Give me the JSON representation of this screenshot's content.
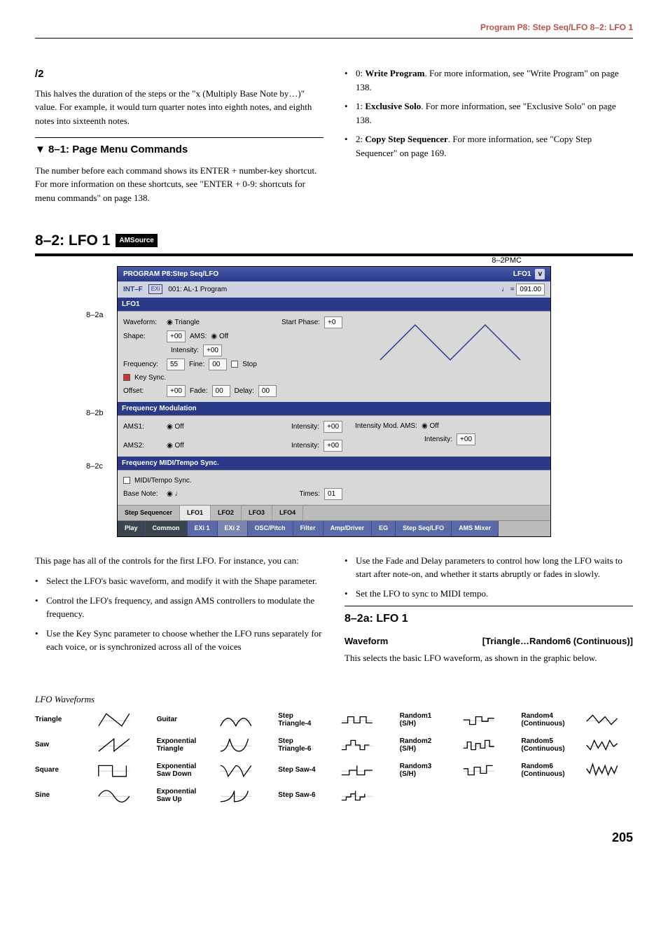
{
  "header": "Program P8: Step Seq/LFO     8–2: LFO 1",
  "left": {
    "half_title": "/2",
    "half_body": "This halves the duration of the steps or the \"x (Multiply Base Note by…)\" value. For example, it would turn quarter notes into eighth notes, and eighth notes into sixteenth notes.",
    "menu_title": "8–1: Page Menu Commands",
    "menu_body": "The number before each command shows its ENTER + number-key shortcut. For more information on these shortcuts, see \"ENTER + 0-9: shortcuts for menu commands\" on page 138."
  },
  "right_items": [
    "0: <b>Write Program</b>. For more information, see \"Write Program\" on page 138.",
    "1: <b>Exclusive Solo</b>. For more information, see \"Exclusive Solo\" on page 138.",
    "2: <b>Copy Step Sequencer</b>. For more information, see \"Copy Step Sequencer\" on page 169."
  ],
  "big_title": "8–2: LFO 1",
  "big_badge": "AMSource",
  "callouts": {
    "pmc": "8–2PMC",
    "a": "8–2a",
    "b": "8–2b",
    "c": "8–2c"
  },
  "shot": {
    "title": "PROGRAM P8:Step Seq/LFO",
    "title_right": "LFO1",
    "tempo": "091.00",
    "subbar_int": "INT–F",
    "subbar_exi": "EXi",
    "subbar_prog": "001: AL-1 Program",
    "sec_lfo1": "LFO1",
    "waveform_lbl": "Waveform:",
    "waveform_val": "Triangle",
    "startphase_lbl": "Start Phase:",
    "startphase_val": "+0",
    "shape_lbl": "Shape:",
    "shape_val": "+00",
    "ams_lbl": "AMS:",
    "ams_val": "Off",
    "intensity_lbl": "Intensity:",
    "intensity_val": "+00",
    "freq_lbl": "Frequency:",
    "freq_val": "55",
    "fine_lbl": "Fine:",
    "fine_val": "00",
    "stop_lbl": "Stop",
    "keysync_lbl": "Key Sync.",
    "offset_lbl": "Offset:",
    "offset_val": "+00",
    "fade_lbl": "Fade:",
    "fade_val": "00",
    "delay_lbl": "Delay:",
    "delay_val": "00",
    "sec_freqmod": "Frequency Modulation",
    "ams1_lbl": "AMS1:",
    "ams1_val": "Off",
    "ams1_int_lbl": "Intensity:",
    "ams1_int_val": "+00",
    "imams_lbl": "Intensity Mod. AMS:",
    "imams_val": "Off",
    "imint_lbl": "Intensity:",
    "imint_val": "+00",
    "ams2_lbl": "AMS2:",
    "ams2_val": "Off",
    "ams2_int_lbl": "Intensity:",
    "ams2_int_val": "+00",
    "sec_midisync": "Frequency MIDI/Tempo Sync.",
    "mts_lbl": "MIDI/Tempo Sync.",
    "base_lbl": "Base Note:",
    "base_val": "♩",
    "times_lbl": "Times:",
    "times_val": "01",
    "tabs_upper": [
      "Step Sequencer",
      "LFO1",
      "LFO2",
      "LFO3",
      "LFO4"
    ],
    "tabs_lower": [
      "Play",
      "Common",
      "EXi 1",
      "EXi 2",
      "OSC/Pitch",
      "Filter",
      "Amp/Driver",
      "EG",
      "Step Seq/LFO",
      "AMS Mixer"
    ]
  },
  "intro_l": "This page has all of the controls for the first LFO. For instance, you can:",
  "intro_l_items": [
    "Select the LFO's basic waveform, and modify it with the Shape parameter.",
    "Control the LFO's frequency, and assign AMS controllers to modulate the frequency.",
    "Use the Key Sync parameter to choose whether the LFO runs separately for each voice, or is synchronized across all of the voices"
  ],
  "intro_r_items": [
    "Use the Fade and Delay parameters to control how long the LFO waits to start after note-on, and whether it starts abruptly or fades in slowly.",
    "Set the LFO to sync to MIDI tempo."
  ],
  "sec82a_title": "8–2a: LFO 1",
  "param_name": "Waveform",
  "param_range": "[Triangle…Random6 (Continuous)]",
  "param_body": "This selects the basic LFO waveform, as shown in the graphic below.",
  "wave_title": "LFO Waveforms",
  "waves": {
    "c1": [
      "Triangle",
      "Saw",
      "Square",
      "Sine"
    ],
    "c2": [
      "Guitar",
      "Exponential Triangle",
      "Exponential Saw Down",
      "Exponential Saw Up"
    ],
    "c3": [
      "Step Triangle-4",
      "Step Triangle-6",
      "Step Saw-4",
      "Step Saw-6"
    ],
    "c4": [
      "Random1 (S/H)",
      "Random2 (S/H)",
      "Random3 (S/H)"
    ],
    "c5": [
      "Random4 (Continuous)",
      "Random5 (Continuous)",
      "Random6 (Continuous)"
    ]
  },
  "page_num": "205"
}
